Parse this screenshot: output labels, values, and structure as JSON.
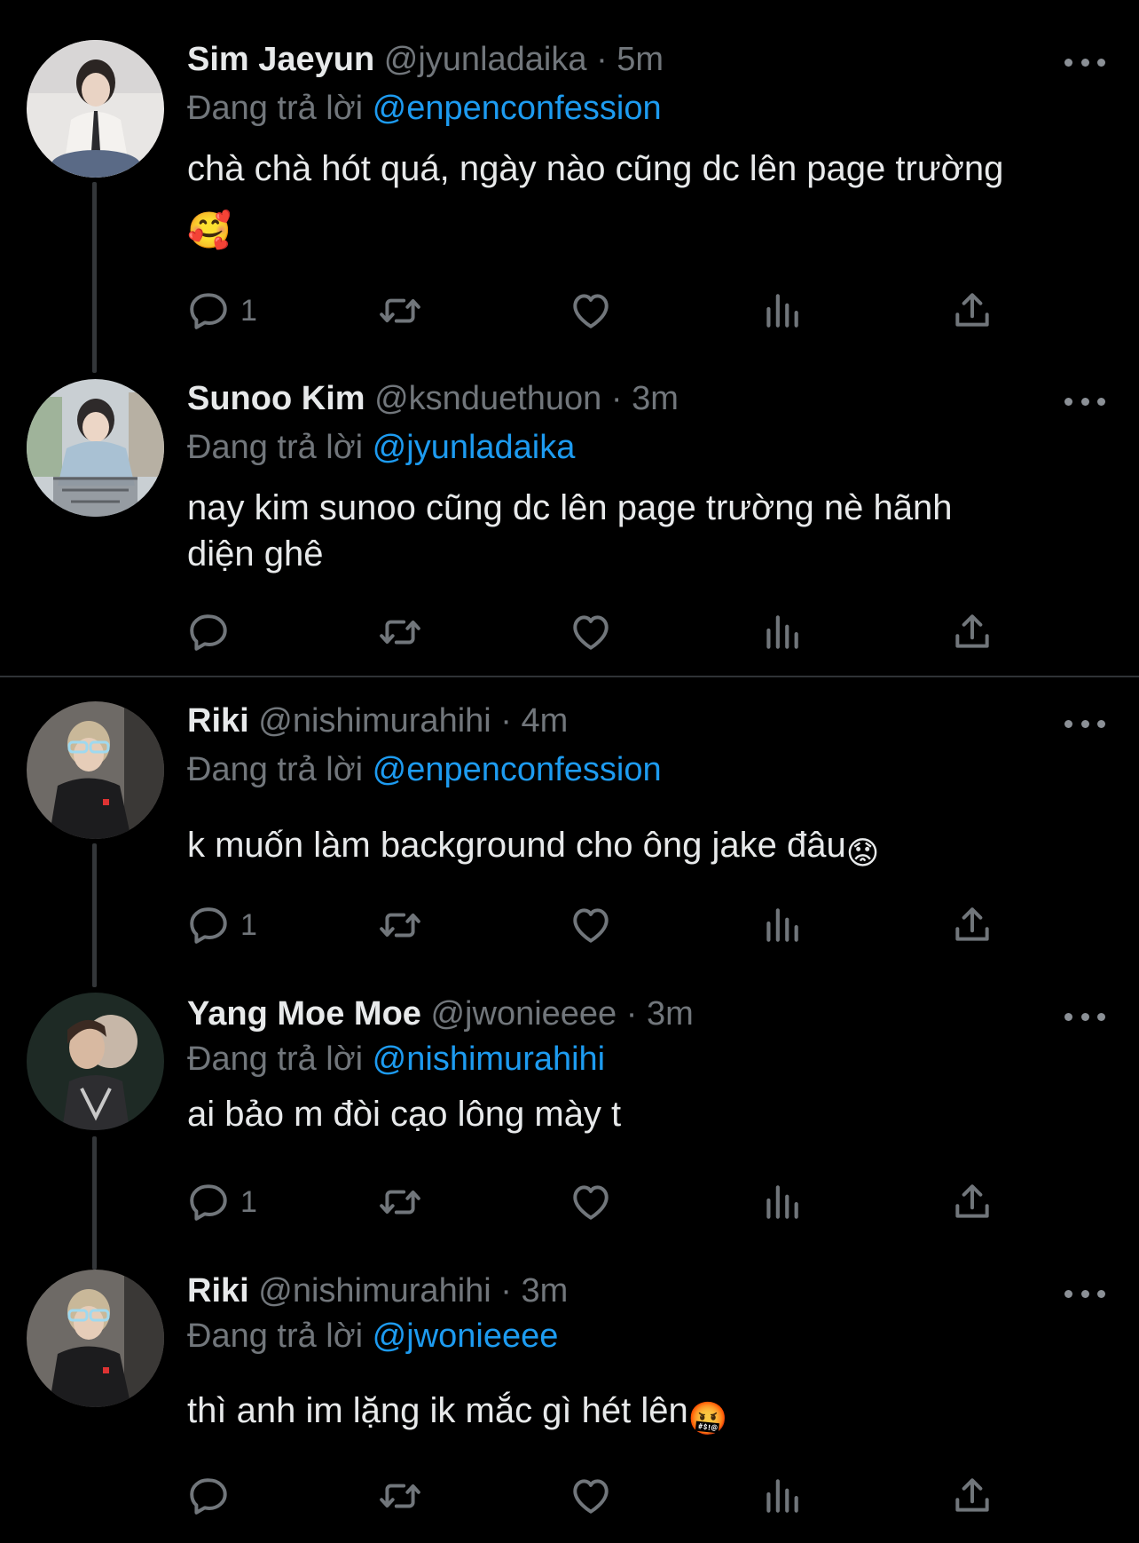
{
  "tweets": [
    {
      "name": "Sim Jaeyun",
      "handle": "@jyunladaika",
      "dot": "·",
      "time": "5m",
      "reply_prefix": "Đang trả lời",
      "reply_to": "@enpenconfession",
      "text": "chà chà hót quá, ngày nào cũng dc lên page trường",
      "emoji": "🥰",
      "reply_count": "1"
    },
    {
      "name": "Sunoo Kim",
      "handle": "@ksnduethuon",
      "dot": "·",
      "time": "3m",
      "reply_prefix": "Đang trả lời",
      "reply_to": "@jyunladaika",
      "text_line1": "nay kim sunoo cũng dc lên page trường nè hãnh",
      "text_line2": "diện ghê",
      "reply_count": ""
    },
    {
      "name": "Riki",
      "handle": "@nishimurahihi",
      "dot": "·",
      "time": "4m",
      "reply_prefix": "Đang trả lời",
      "reply_to": "@enpenconfession",
      "text": "k muốn làm background cho ông jake đâu",
      "emoji": "😟",
      "reply_count": "1"
    },
    {
      "name": "Yang Moe Moe",
      "handle": "@jwonieeee",
      "dot": "·",
      "time": "3m",
      "reply_prefix": "Đang trả lời",
      "reply_to": "@nishimurahihi",
      "text": "ai bảo m đòi cạo lông mày t",
      "reply_count": "1"
    },
    {
      "name": "Riki",
      "handle": "@nishimurahihi",
      "dot": "·",
      "time": "3m",
      "reply_prefix": "Đang trả lời",
      "reply_to": "@jwonieeee",
      "text": "thì anh im lặng ik mắc gì hét lên",
      "emoji": "🤬",
      "reply_count": ""
    }
  ],
  "icons": [
    "more-icon",
    "reply-icon",
    "retweet-icon",
    "like-icon",
    "analytics-icon",
    "share-icon"
  ],
  "colors": {
    "background": "#000000",
    "text": "#e7e9ea",
    "secondary": "#71767b",
    "link": "#1d9bf0",
    "divider": "#2f3336"
  }
}
